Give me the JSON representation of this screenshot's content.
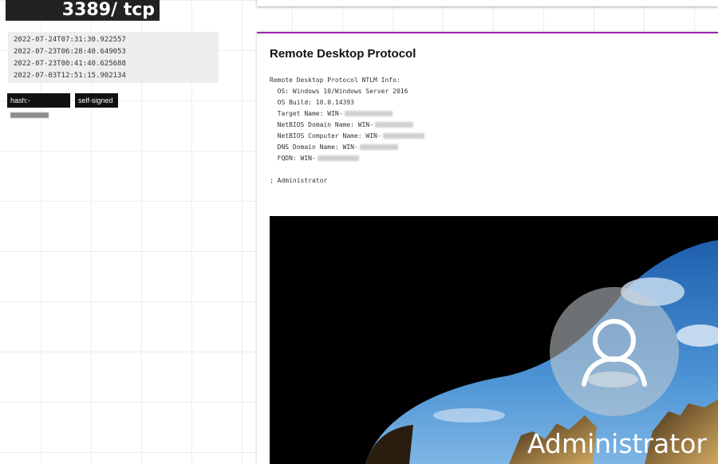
{
  "port": {
    "label": "3389/ tcp"
  },
  "timestamps": [
    "2022-07-24T07:31:30.922557",
    "2022-07-23T06:28:40.649053",
    "2022-07-23T00:41:40.625688",
    "2022-07-03T12:51:15.902134"
  ],
  "tags": {
    "hash_prefix": "hash:-",
    "self_signed": "self-signed"
  },
  "card": {
    "title": "Remote Desktop Protocol",
    "info_header": "Remote Desktop Protocol NTLM Info:",
    "os": "  OS: Windows 10/Windows Server 2016",
    "os_build": "  OS Build: 10.0.14393",
    "target_name": "  Target Name: WIN-",
    "netbios_domain": "  NetBIOS Domain Name: WIN-",
    "netbios_computer": "  NetBIOS Computer Name: WIN-",
    "dns_domain": "  DNS Domain Name: WIN-",
    "fqdn": "  FQDN: WIN-",
    "user_line": "; Administrator"
  },
  "screenshot": {
    "username": "Administrator",
    "icon": "user-avatar-icon"
  },
  "colors": {
    "accent": "#9c27b0",
    "header_bg": "#222222",
    "tag_bg": "#111111"
  }
}
